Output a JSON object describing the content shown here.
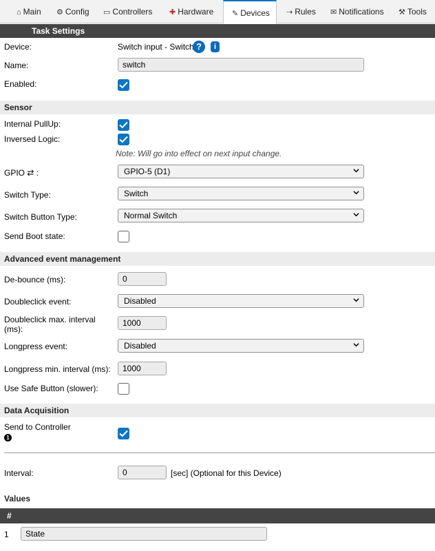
{
  "tabs": [
    {
      "label": "Main",
      "icon": "home-icon",
      "glyph": "⌂"
    },
    {
      "label": "Config",
      "icon": "gear-icon",
      "glyph": "⚙"
    },
    {
      "label": "Controllers",
      "icon": "controller-icon",
      "glyph": "💬"
    },
    {
      "label": "Hardware",
      "icon": "pin-icon",
      "glyph": "📌"
    },
    {
      "label": "Devices",
      "icon": "plug-icon",
      "glyph": "✎"
    },
    {
      "label": "Rules",
      "icon": "arrow-icon",
      "glyph": "→"
    },
    {
      "label": "Notifications",
      "icon": "mail-icon",
      "glyph": "✉"
    },
    {
      "label": "Tools",
      "icon": "wrench-icon",
      "glyph": "🔧"
    }
  ],
  "task_settings": {
    "header": "Task Settings",
    "device_label": "Device:",
    "device_value": "Switch input - Switch",
    "name_label": "Name:",
    "name_value": "switch",
    "enabled_label": "Enabled:",
    "enabled": true
  },
  "sensor": {
    "header": "Sensor",
    "pullup_label": "Internal PullUp:",
    "pullup": true,
    "inversed_label": "Inversed Logic:",
    "inversed": true,
    "note": "Note: Will go into effect on next input change.",
    "gpio_label": "GPIO ⇄ :",
    "gpio_value": "GPIO-5 (D1)",
    "switch_type_label": "Switch Type:",
    "switch_type_value": "Switch",
    "button_type_label": "Switch Button Type:",
    "button_type_value": "Normal Switch",
    "boot_label": "Send Boot state:",
    "boot": false
  },
  "advanced": {
    "header": "Advanced event management",
    "debounce_label": "De-bounce (ms):",
    "debounce_value": "0",
    "dblclick_label": "Doubleclick event:",
    "dblclick_value": "Disabled",
    "dblclick_interval_label_1": "Doubleclick max. interval",
    "dblclick_interval_label_2": "(ms):",
    "dblclick_interval_value": "1000",
    "longpress_label": "Longpress event:",
    "longpress_value": "Disabled",
    "longpress_interval_label": "Longpress min. interval (ms):",
    "longpress_interval_value": "1000",
    "safe_button_label": "Use Safe Button (slower):",
    "safe_button": false
  },
  "acquisition": {
    "header": "Data Acquisition",
    "send_label": "Send to Controller",
    "send_marker": "1",
    "send": true,
    "interval_label": "Interval:",
    "interval_value": "0",
    "interval_hint": "[sec] (Optional for this Device)"
  },
  "values": {
    "header": "Values",
    "col_hash": "#",
    "rows": [
      {
        "index": "1",
        "name": "State"
      }
    ]
  },
  "colors": {
    "accent": "#0b76c2",
    "dark_header": "#444444",
    "light_header": "#ececec"
  }
}
